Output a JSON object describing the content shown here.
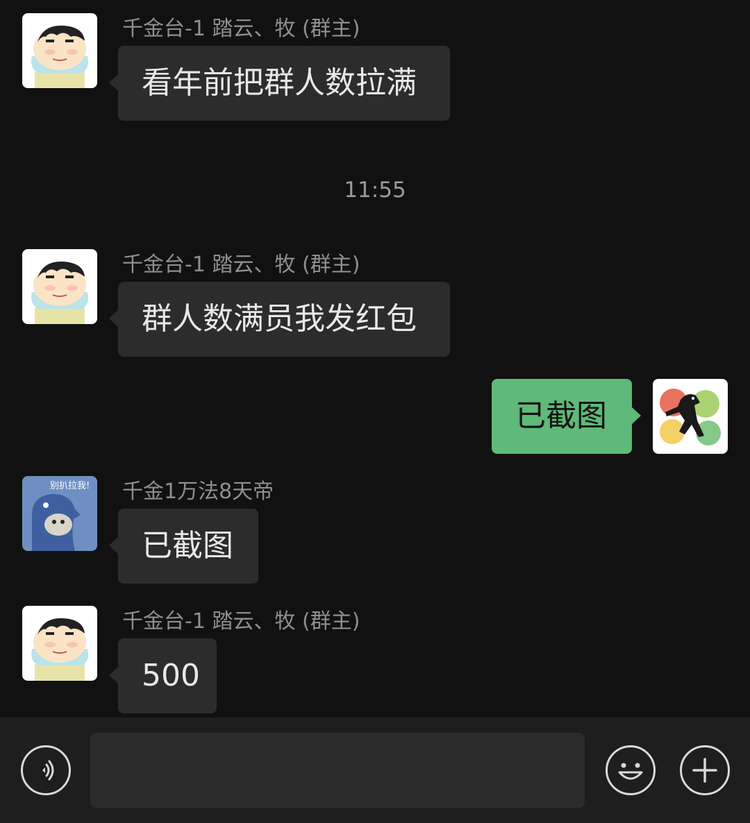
{
  "colors": {
    "background": "#111111",
    "bubble_in": "#2c2c2c",
    "bubble_out": "#5fb978",
    "input_bar": "#1e1e1e"
  },
  "messages": [
    {
      "sender": "千金台-1 踏云、牧 (群主)",
      "text": "看年前把群人数拉满",
      "avatar": "crayon-shinchan-avatar"
    },
    {
      "time": "11:55"
    },
    {
      "sender": "千金台-1 踏云、牧 (群主)",
      "text": "群人数满员我发红包",
      "avatar": "crayon-shinchan-avatar"
    },
    {
      "text": "已截图",
      "outgoing": true,
      "avatar": "black-horse-avatar"
    },
    {
      "sender": "千金1万法8天帝",
      "text": "已截图",
      "avatar": "blue-dinosaur-avatar",
      "sticker_text": "别扒拉我!"
    },
    {
      "sender": "千金台-1 踏云、牧 (群主)",
      "text": "500",
      "avatar": "crayon-shinchan-avatar"
    }
  ],
  "input_bar": {
    "voice_icon": "voice-icon",
    "message_value": "",
    "emoji_icon": "emoji-icon",
    "plus_icon": "plus-icon"
  }
}
